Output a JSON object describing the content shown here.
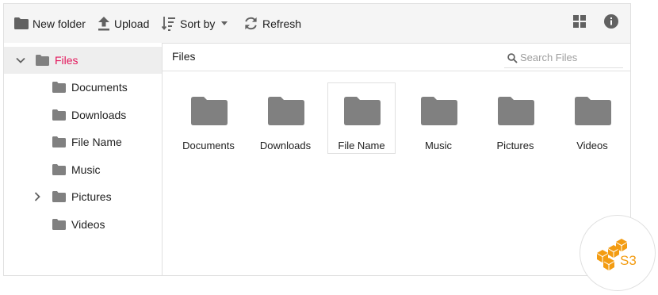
{
  "toolbar": {
    "new_folder": "New folder",
    "upload": "Upload",
    "sort_by": "Sort by",
    "refresh": "Refresh"
  },
  "navigation": {
    "root": "Files",
    "items": [
      {
        "label": "Documents"
      },
      {
        "label": "Downloads"
      },
      {
        "label": "File Name"
      },
      {
        "label": "Music"
      },
      {
        "label": "Pictures"
      },
      {
        "label": "Videos"
      }
    ]
  },
  "address_bar": {
    "path": "Files",
    "search_placeholder": "Search Files"
  },
  "files": [
    {
      "name": "Documents"
    },
    {
      "name": "Downloads"
    },
    {
      "name": "File Name",
      "selected": true
    },
    {
      "name": "Music"
    },
    {
      "name": "Pictures"
    },
    {
      "name": "Videos"
    }
  ],
  "badge": {
    "label": "S3"
  },
  "colors": {
    "accent": "#e3165b",
    "folder": "#808080",
    "icon": "#616161",
    "s3_orange": "#f39c12"
  },
  "icons": {
    "toolbar": [
      "folder-icon",
      "upload-icon",
      "sort-icon",
      "chevron-down-icon",
      "refresh-icon",
      "grid-view-icon",
      "info-icon"
    ],
    "nav": [
      "chevron-down-icon",
      "chevron-right-icon",
      "folder-icon"
    ],
    "content": [
      "search-icon",
      "folder-icon"
    ],
    "badge": [
      "aws-s3-cubes-icon"
    ]
  }
}
